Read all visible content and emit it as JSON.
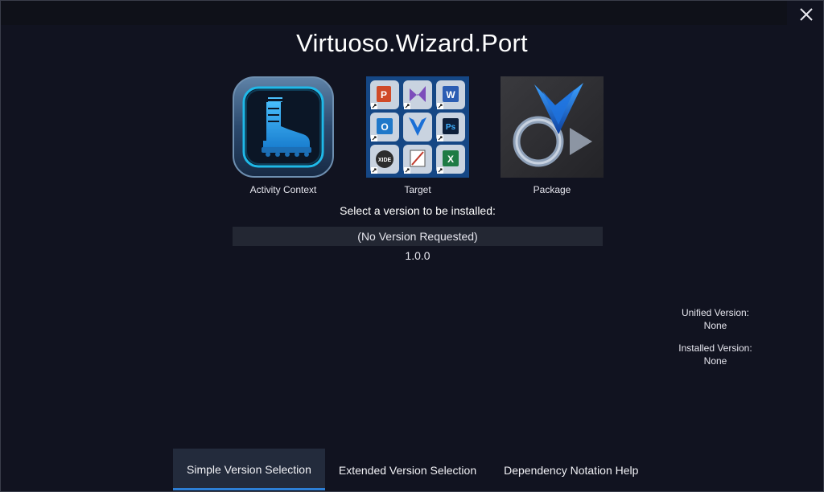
{
  "window": {
    "title": "Virtuoso.Wizard.Port",
    "close_icon": "close-icon"
  },
  "tiles": [
    {
      "label": "Activity Context",
      "icon": "boot-icon"
    },
    {
      "label": "Target",
      "icon": "app-grid-icon"
    },
    {
      "label": "Package",
      "icon": "package-icon"
    }
  ],
  "version_selection": {
    "prompt": "Select a version to be installed:",
    "options": [
      "(No Version Requested)",
      "1.0.0"
    ],
    "selected_index": 0
  },
  "info": {
    "unified_label": "Unified Version:",
    "unified_value": "None",
    "installed_label": "Installed Version:",
    "installed_value": "None"
  },
  "tabs": [
    {
      "label": "Simple Version Selection",
      "active": true
    },
    {
      "label": "Extended Version Selection",
      "active": false
    },
    {
      "label": "Dependency Notation Help",
      "active": false
    }
  ],
  "colors": {
    "background": "#111320",
    "accent": "#2d7fd6",
    "selected_row": "#232733"
  }
}
